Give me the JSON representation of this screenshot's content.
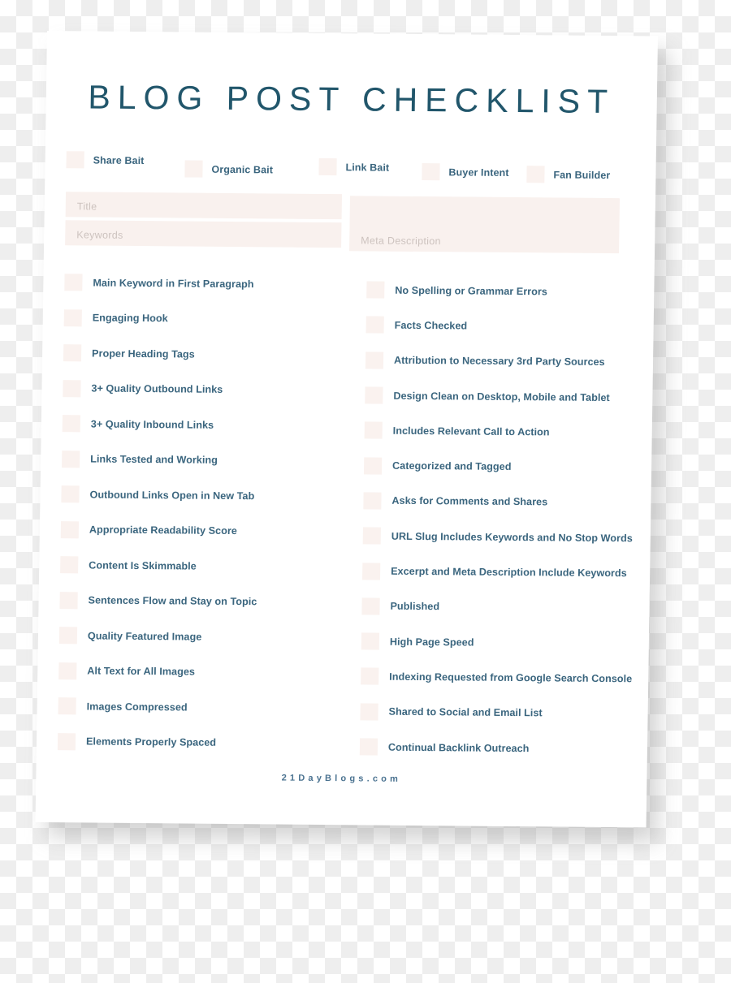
{
  "document": {
    "title": "BLOG POST CHECKLIST",
    "footer": "21DayBlogs.com"
  },
  "colors": {
    "title": "#21566b",
    "text": "#3a657e",
    "checkbox_fill": "#faf2ef",
    "field_fill": "#f9f1ee",
    "placeholder": "#cdc3bf",
    "paper": "#ffffff",
    "footer": "#4a7290"
  },
  "bait_types": [
    {
      "label": "Share Bait",
      "checked": false
    },
    {
      "label": "Organic Bait",
      "checked": false
    },
    {
      "label": "Link Bait",
      "checked": false
    },
    {
      "label": "Buyer Intent",
      "checked": false
    },
    {
      "label": "Fan Builder",
      "checked": false
    }
  ],
  "fields": [
    {
      "name": "title",
      "value": "",
      "placeholder": "Title"
    },
    {
      "name": "keywords",
      "value": "",
      "placeholder": "Keywords"
    },
    {
      "name": "meta_description",
      "value": "",
      "placeholder": "Meta Description"
    }
  ],
  "checklist_left": [
    {
      "label": "Main Keyword in First Paragraph",
      "checked": false
    },
    {
      "label": "Engaging Hook",
      "checked": false
    },
    {
      "label": "Proper Heading Tags",
      "checked": false
    },
    {
      "label": "3+ Quality Outbound Links",
      "checked": false
    },
    {
      "label": "3+ Quality Inbound Links",
      "checked": false
    },
    {
      "label": "Links Tested and Working",
      "checked": false
    },
    {
      "label": "Outbound Links Open in New Tab",
      "checked": false
    },
    {
      "label": "Appropriate Readability Score",
      "checked": false
    },
    {
      "label": "Content Is Skimmable",
      "checked": false
    },
    {
      "label": "Sentences Flow and Stay on Topic",
      "checked": false
    },
    {
      "label": "Quality Featured Image",
      "checked": false
    },
    {
      "label": "Alt Text for All Images",
      "checked": false
    },
    {
      "label": "Images Compressed",
      "checked": false
    },
    {
      "label": "Elements Properly Spaced",
      "checked": false
    }
  ],
  "checklist_right": [
    {
      "label": "No Spelling or Grammar Errors",
      "checked": false
    },
    {
      "label": "Facts Checked",
      "checked": false
    },
    {
      "label": "Attribution to Necessary 3rd Party Sources",
      "checked": false
    },
    {
      "label": "Design Clean on Desktop, Mobile and Tablet",
      "checked": false
    },
    {
      "label": "Includes Relevant Call to Action",
      "checked": false
    },
    {
      "label": "Categorized and Tagged",
      "checked": false
    },
    {
      "label": "Asks for Comments and Shares",
      "checked": false
    },
    {
      "label": "URL Slug Includes Keywords and No Stop Words",
      "checked": false
    },
    {
      "label": "Excerpt and Meta Description Include Keywords",
      "checked": false
    },
    {
      "label": "Published",
      "checked": false
    },
    {
      "label": "High Page Speed",
      "checked": false
    },
    {
      "label": "Indexing Requested from Google Search Console",
      "checked": false
    },
    {
      "label": "Shared to Social and Email List",
      "checked": false
    },
    {
      "label": "Continual Backlink Outreach",
      "checked": false
    }
  ]
}
